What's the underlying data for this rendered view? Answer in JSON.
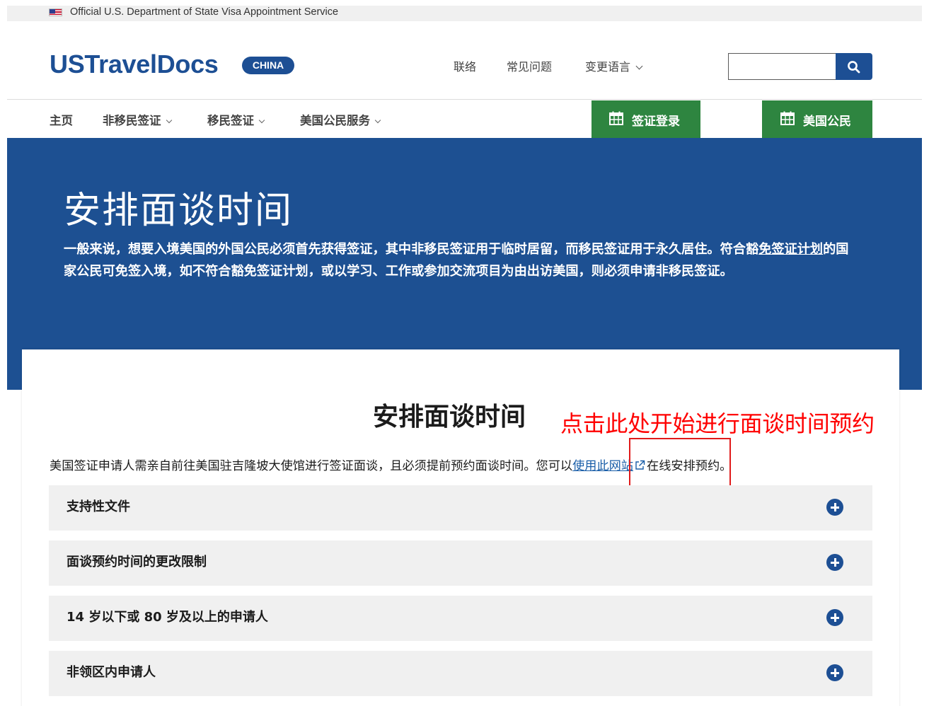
{
  "banner": {
    "text": "Official U.S. Department of State Visa Appointment Service",
    "icon": "us-flag-icon"
  },
  "header": {
    "logo": "USTravelDocs",
    "badge": "CHINA",
    "links": {
      "contact": "联络",
      "faq": "常见问题",
      "language": "变更语言"
    },
    "search": {
      "placeholder": "",
      "value": "",
      "icon": "search-icon"
    }
  },
  "nav": {
    "home": "主页",
    "nonimmigrant": "非移民签证",
    "immigrant": "移民签证",
    "citizen_services": "美国公民服务",
    "visa_login": "签证登录",
    "us_citizen": "美国公民",
    "calendar_icon": "calendar-icon"
  },
  "hero": {
    "title": "安排面谈时间",
    "text_part1": "一般来说，想要入境美国的外国公民必须首先获得签证，其中非移民签证用于临时居留，而移民签证用于永久居住。符合豁",
    "vwp_link": "免签证计划",
    "text_part2": "的国家公民可免签入境，如不符合豁免签证计划，或以学习、工作或参加交流项目为由出访美国，则必须申请非移民签证。"
  },
  "main": {
    "title": "安排面谈时间",
    "annotation": "点击此处开始进行面谈时间预约",
    "intro_before": "美国签证申请人需亲自前往美国驻吉隆坡大使馆进行签证面谈，且必须提前预约面谈时间。您可以",
    "intro_link": "使用此网站",
    "intro_after": "在线安排预约。",
    "accordions": [
      {
        "label": "支持性文件"
      },
      {
        "label": "面谈预约时间的更改限制"
      },
      {
        "label": "14 岁以下或 80 岁及以上的申请人"
      },
      {
        "label": "非领区内申请人"
      }
    ]
  },
  "colors": {
    "brand": "#1d4f94",
    "hero": "#1d5092",
    "green": "#2e8540",
    "annotation": "#ff0000",
    "accordion_bg": "#f0f0f0"
  }
}
